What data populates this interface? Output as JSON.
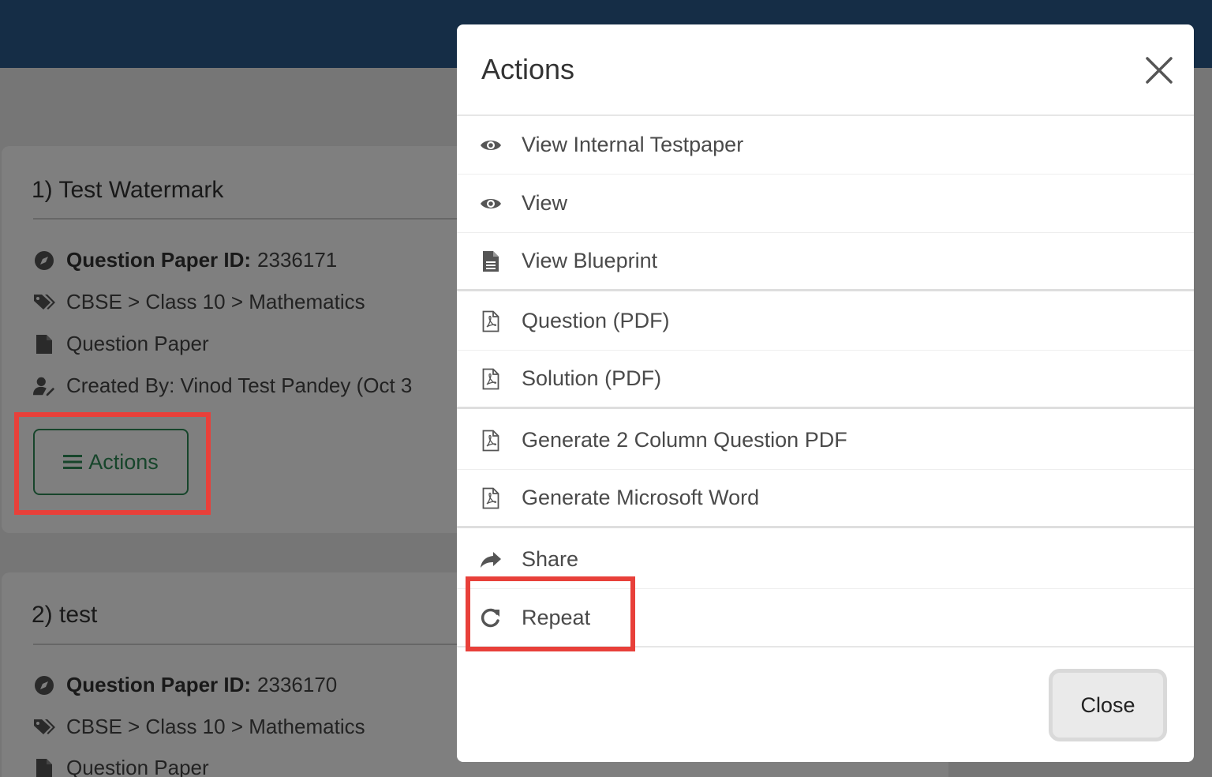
{
  "background": {
    "cards": [
      {
        "title": "1) Test Watermark",
        "question_paper_id_label": "Question Paper ID:",
        "question_paper_id": "2336171",
        "category": "CBSE > Class 10 > Mathematics",
        "type": "Question Paper",
        "created_by": "Created By: Vinod Test Pandey (Oct 3",
        "actions_label": "Actions"
      },
      {
        "title": "2) test",
        "question_paper_id_label": "Question Paper ID:",
        "question_paper_id": "2336170",
        "category": "CBSE > Class 10 > Mathematics",
        "type": "Question Paper"
      }
    ]
  },
  "modal": {
    "title": "Actions",
    "items": [
      {
        "label": "View Internal Testpaper",
        "icon": "eye-icon"
      },
      {
        "label": "View",
        "icon": "eye-icon"
      },
      {
        "label": "View Blueprint",
        "icon": "document-icon"
      },
      {
        "label": "Question (PDF)",
        "icon": "pdf-icon"
      },
      {
        "label": "Solution (PDF)",
        "icon": "pdf-icon"
      },
      {
        "label": "Generate 2 Column Question PDF",
        "icon": "pdf-icon"
      },
      {
        "label": "Generate Microsoft Word",
        "icon": "pdf-icon"
      },
      {
        "label": "Share",
        "icon": "share-icon"
      },
      {
        "label": "Repeat",
        "icon": "repeat-icon"
      }
    ],
    "close_label": "Close"
  },
  "colors": {
    "topbar": "#2a5a8c",
    "accent_green": "#2e8b57",
    "highlight_red": "#e8403a"
  }
}
